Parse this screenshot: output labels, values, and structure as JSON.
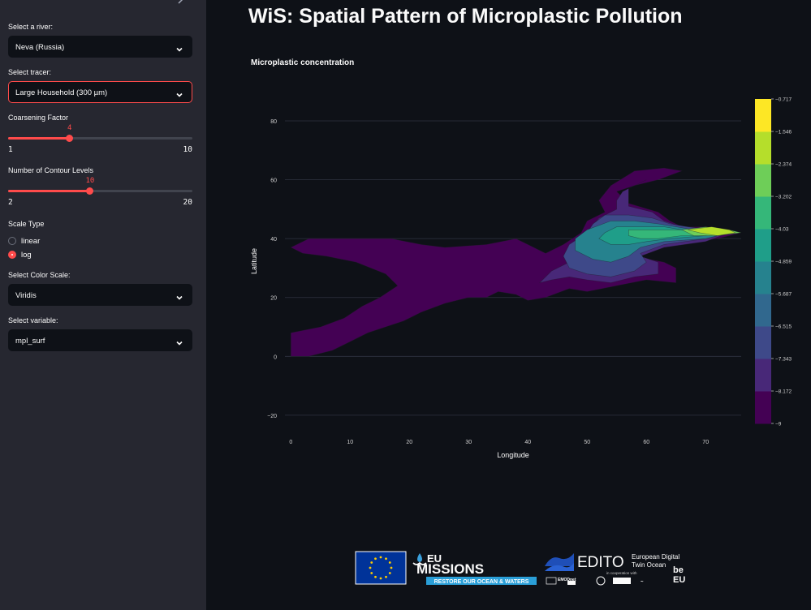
{
  "sidebar": {
    "river": {
      "label": "Select a river:",
      "value": "Neva (Russia)"
    },
    "tracer": {
      "label": "Select tracer:",
      "value": "Large Household (300 µm)"
    },
    "coarsening": {
      "label": "Coarsening Factor",
      "value": 4,
      "value_text": "4",
      "min": 1,
      "max": 10,
      "min_text": "1",
      "max_text": "10"
    },
    "contours": {
      "label": "Number of Contour Levels",
      "value": 10,
      "value_text": "10",
      "min": 2,
      "max": 20,
      "min_text": "2",
      "max_text": "20"
    },
    "scale": {
      "label": "Scale Type",
      "options": [
        "linear",
        "log"
      ],
      "selected": "log"
    },
    "color_scale": {
      "label": "Select Color Scale:",
      "value": "Viridis"
    },
    "variable": {
      "label": "Select variable:",
      "value": "mpl_surf"
    }
  },
  "main": {
    "title": "WiS: Spatial Pattern of Microplastic Pollution"
  },
  "logos": {
    "eu_missions": "EU",
    "missions_word": "MISSIONS",
    "missions_tag": "RESTORE OUR OCEAN & WATERS",
    "edito": "EDITO",
    "edito_sub1": "European Digital",
    "edito_sub2": "Twin Ocean",
    "coop": "in cooperation with",
    "emodnet": "EMODnet",
    "beeu1": "be",
    "beeu2": "EU"
  },
  "colors": {
    "accent": "#ff4b4b",
    "sidebar_bg": "#262730",
    "app_bg": "#0e1117"
  },
  "chart_data": {
    "type": "contour",
    "title": "Microplastic concentration",
    "xlabel": "Longitude",
    "ylabel": "Latitude",
    "xlim": [
      -1,
      76
    ],
    "ylim": [
      -25,
      88
    ],
    "x_ticks": [
      0,
      10,
      20,
      30,
      40,
      50,
      60,
      70
    ],
    "y_ticks": [
      -20,
      0,
      20,
      40,
      60,
      80
    ],
    "colorscale": "Viridis",
    "colorbar_ticks": [
      -0.717,
      -1.546,
      -2.374,
      -3.202,
      -4.03,
      -4.859,
      -5.687,
      -6.515,
      -7.343,
      -8.172,
      -9
    ],
    "colorbar_tick_labels": [
      "−0.717",
      "−1.546",
      "−2.374",
      "−3.202",
      "−4.03",
      "−4.859",
      "−5.687",
      "−6.515",
      "−7.343",
      "−8.172",
      "−9"
    ],
    "grid": true,
    "regions": [
      {
        "level": 0,
        "points": [
          [
            52,
            53
          ],
          [
            54,
            58
          ],
          [
            58,
            63
          ],
          [
            63,
            64
          ],
          [
            66,
            63
          ],
          [
            62,
            60
          ],
          [
            58,
            58
          ],
          [
            55,
            56
          ],
          [
            57,
            52
          ],
          [
            62,
            49
          ],
          [
            64,
            46
          ],
          [
            66,
            44
          ],
          [
            70,
            44
          ],
          [
            76,
            42
          ],
          [
            76,
            42
          ],
          [
            72,
            40
          ],
          [
            65,
            38
          ],
          [
            60,
            36
          ],
          [
            58,
            34
          ],
          [
            63,
            32
          ],
          [
            65,
            30
          ],
          [
            65,
            25
          ],
          [
            60,
            26
          ],
          [
            55,
            24
          ],
          [
            50,
            22
          ],
          [
            47,
            23
          ],
          [
            43,
            20
          ],
          [
            40,
            19
          ],
          [
            38,
            21
          ],
          [
            35,
            22
          ],
          [
            33,
            20
          ],
          [
            30,
            20
          ],
          [
            26,
            18
          ],
          [
            22,
            15
          ],
          [
            19,
            12
          ],
          [
            16,
            10
          ],
          [
            13,
            8
          ],
          [
            10,
            5
          ],
          [
            7,
            2
          ],
          [
            3,
            0
          ],
          [
            0,
            0
          ],
          [
            0,
            8
          ],
          [
            5,
            10
          ],
          [
            9,
            13
          ],
          [
            12,
            17
          ],
          [
            15,
            20
          ],
          [
            18,
            24
          ],
          [
            16,
            28
          ],
          [
            11,
            32
          ],
          [
            6,
            34
          ],
          [
            2,
            35
          ],
          [
            0,
            37
          ],
          [
            3,
            40
          ],
          [
            8,
            40
          ],
          [
            17,
            40
          ],
          [
            22,
            38
          ],
          [
            26,
            37
          ],
          [
            33,
            38
          ],
          [
            38,
            40
          ],
          [
            40,
            38
          ],
          [
            43,
            35
          ],
          [
            46,
            38
          ],
          [
            49,
            42
          ],
          [
            50,
            46
          ],
          [
            53,
            49
          ]
        ]
      },
      {
        "level": 1,
        "points": [
          [
            55,
            53
          ],
          [
            56,
            56
          ],
          [
            60,
            60
          ],
          [
            57,
            57
          ],
          [
            57,
            51
          ],
          [
            61,
            49
          ],
          [
            63,
            46
          ],
          [
            66,
            44
          ],
          [
            70,
            43
          ],
          [
            74,
            42
          ],
          [
            70,
            39
          ],
          [
            63,
            37
          ],
          [
            59,
            34
          ],
          [
            62,
            32
          ],
          [
            62,
            28
          ],
          [
            58,
            27
          ],
          [
            54,
            25
          ],
          [
            50,
            26
          ],
          [
            47,
            27
          ],
          [
            44,
            26
          ],
          [
            42,
            25
          ],
          [
            44,
            29
          ],
          [
            47,
            32
          ],
          [
            48,
            37
          ],
          [
            50,
            42
          ],
          [
            52,
            47
          ],
          [
            55,
            50
          ]
        ]
      },
      {
        "level": 2,
        "points": [
          [
            53,
            48
          ],
          [
            57,
            48
          ],
          [
            61,
            47
          ],
          [
            64,
            45
          ],
          [
            67,
            44
          ],
          [
            71,
            43
          ],
          [
            74,
            42
          ],
          [
            70,
            40
          ],
          [
            63,
            38
          ],
          [
            59,
            35
          ],
          [
            60,
            32
          ],
          [
            58,
            29
          ],
          [
            54,
            27
          ],
          [
            50,
            28
          ],
          [
            47,
            30
          ],
          [
            46,
            34
          ],
          [
            47,
            38
          ],
          [
            50,
            42
          ],
          [
            51,
            45
          ]
        ]
      },
      {
        "level": 3,
        "points": [
          [
            54,
            46
          ],
          [
            58,
            46
          ],
          [
            62,
            45
          ],
          [
            65,
            44
          ],
          [
            68,
            43
          ],
          [
            72,
            43
          ],
          [
            74,
            42
          ],
          [
            70,
            40
          ],
          [
            63,
            39
          ],
          [
            59,
            37
          ],
          [
            57,
            34
          ],
          [
            54,
            32
          ],
          [
            51,
            33
          ],
          [
            48,
            36
          ],
          [
            48,
            40
          ],
          [
            50,
            43
          ]
        ]
      },
      {
        "level": 4,
        "points": [
          [
            55,
            44
          ],
          [
            59,
            44
          ],
          [
            63,
            44
          ],
          [
            66,
            43
          ],
          [
            70,
            43
          ],
          [
            74,
            42
          ],
          [
            70,
            41
          ],
          [
            64,
            40
          ],
          [
            60,
            39
          ],
          [
            57,
            38
          ],
          [
            54,
            38
          ],
          [
            52,
            40
          ],
          [
            53,
            42
          ]
        ]
      },
      {
        "level": 5,
        "points": [
          [
            57,
            43
          ],
          [
            61,
            43
          ],
          [
            64,
            43
          ],
          [
            68,
            43
          ],
          [
            72,
            43
          ],
          [
            75,
            42
          ],
          [
            71,
            41
          ],
          [
            66,
            41
          ],
          [
            62,
            40
          ],
          [
            59,
            40
          ],
          [
            57,
            41
          ]
        ]
      },
      {
        "level": 6,
        "points": [
          [
            66,
            43
          ],
          [
            70,
            44
          ],
          [
            74,
            43
          ],
          [
            76,
            42
          ],
          [
            72,
            41
          ],
          [
            68,
            41
          ]
        ]
      },
      {
        "level": 7,
        "points": [
          [
            67,
            43
          ],
          [
            71,
            44
          ],
          [
            74,
            43
          ],
          [
            75,
            42
          ],
          [
            72,
            41
          ],
          [
            69,
            42
          ]
        ]
      }
    ]
  }
}
